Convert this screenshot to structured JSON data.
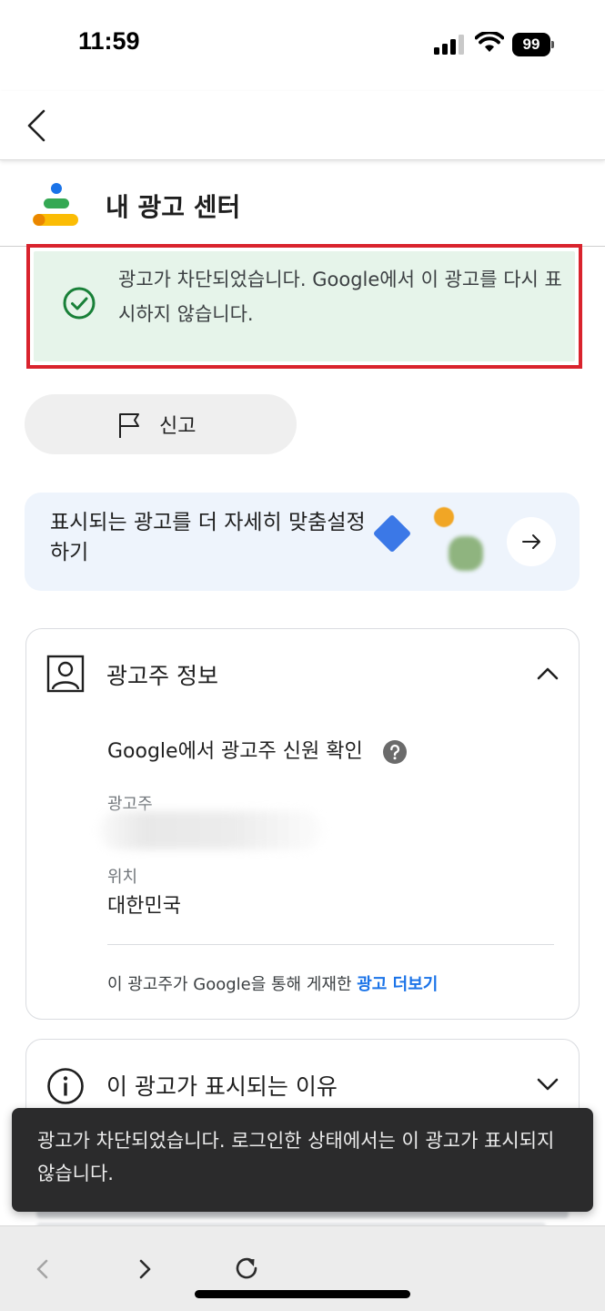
{
  "status_bar": {
    "time": "11:59",
    "battery": "99"
  },
  "app": {
    "title": "내 광고 센터"
  },
  "banner": {
    "message": "광고가 차단되었습니다. Google에서 이 광고를 다시 표시하지 않습니다."
  },
  "report": {
    "label": "신고"
  },
  "customize": {
    "text": "표시되는 광고를 더 자세히 맞춤설정하기"
  },
  "advertiser_card": {
    "title": "광고주 정보",
    "verified": "Google에서 광고주 신원 확인",
    "advertiser_label": "광고주",
    "location_label": "위치",
    "location_value": "대한민국",
    "more_ads_prefix": "이 광고주가 Google을 통해 게재한 ",
    "more_ads_link": "광고 더보기"
  },
  "why_card": {
    "title": "이 광고가 표시되는 이유"
  },
  "toast": {
    "message": "광고가 차단되었습니다. 로그인한 상태에서는 이 광고가 표시되지 않습니다."
  },
  "colors": {
    "highlight_border": "#d9232d",
    "banner_bg": "#e6f4ea",
    "success_green": "#188038",
    "link_blue": "#1a73e8",
    "toast_bg": "#2b2b2c"
  },
  "icons": {
    "back": "chevron-left-icon",
    "check": "check-circle-icon",
    "flag": "flag-icon",
    "arrow": "arrow-right-icon",
    "person": "person-icon",
    "help": "help-icon",
    "info": "info-icon",
    "reload": "reload-icon"
  }
}
